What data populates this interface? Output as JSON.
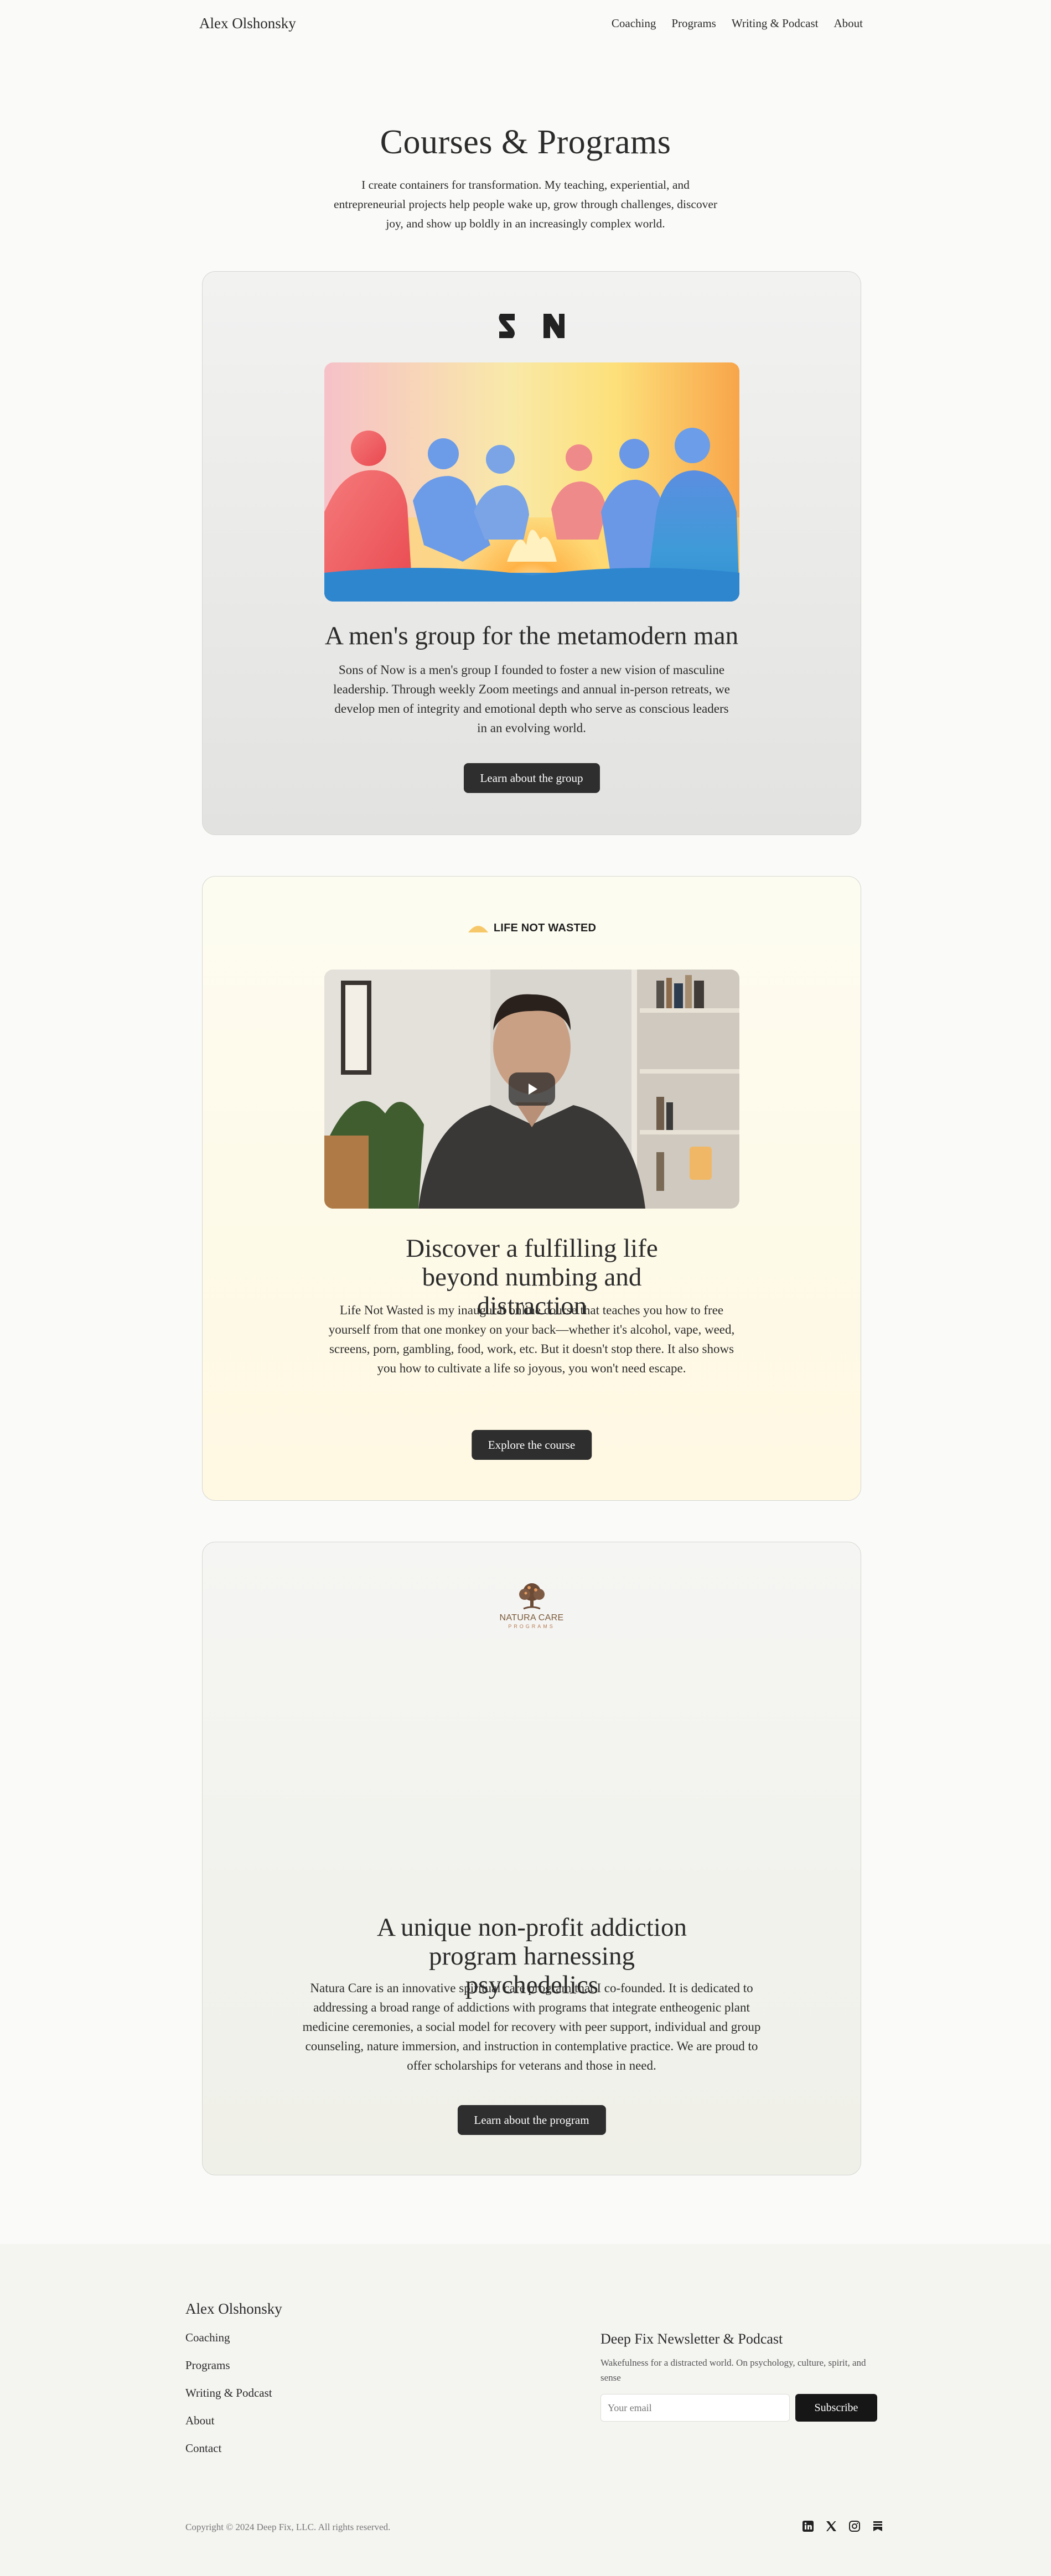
{
  "nav": {
    "brand": "Alex Olshonsky",
    "links": [
      "Coaching",
      "Programs",
      "Writing & Podcast",
      "About"
    ]
  },
  "hero": {
    "title": "Courses & Programs",
    "description": "I create containers for transformation. My teaching, experiential, and entrepreneurial projects help people wake up, grow through challenges, discover joy, and show up boldly in an increasingly complex world."
  },
  "cards": [
    {
      "logo": "SN",
      "title": "A men's group for the metamodern man",
      "description": "Sons of Now is a men's group I founded to foster a new vision of masculine leadership. Through weekly Zoom meetings and annual in-person retreats, we develop men of integrity and emotional depth who serve as conscious leaders in an evolving world.",
      "button": "Learn about the group"
    },
    {
      "logo": "LIFE NOT WASTED",
      "title": "Discover a fulfilling life beyond numbing and distraction",
      "description": "Life Not Wasted is my inaugural online course that teaches you how to free yourself from that one monkey on your back—whether it's alcohol, vape, weed, screens, porn, gambling, food, work, etc. But it doesn't stop there. It also shows you how to cultivate a life so joyous, you won't need escape.",
      "button": "Explore the course"
    },
    {
      "logo": "NATURA CARE",
      "logo_sub": "PROGRAMS",
      "title": "A unique non-profit addiction program harnessing psychedelics",
      "description": "Natura Care is an innovative spiritual care program that I co-founded. It is dedicated to addressing a broad range of addictions with programs that integrate entheogenic plant medicine ceremonies, a social model for recovery with peer support, individual and group counseling, nature immersion, and instruction in contemplative practice. We are proud to offer scholarships for veterans and those in need.",
      "button": "Learn about the program"
    }
  ],
  "footer": {
    "brand": "Alex Olshonsky",
    "links": [
      "Coaching",
      "Programs",
      "Writing & Podcast",
      "About",
      "Contact"
    ],
    "newsletter": {
      "title": "Deep Fix Newsletter & Podcast",
      "description": "Wakefulness for a distracted world. On psychology, culture, spirit, and sense",
      "placeholder": "Your email",
      "button": "Subscribe"
    },
    "copyright": "Copyright © 2024 Deep Fix, LLC. All rights reserved.",
    "social_icons": [
      "linkedin-icon",
      "x-icon",
      "instagram-icon",
      "substack-icon"
    ]
  },
  "colors": {
    "button": "#2e2e2e",
    "subscribe_button": "#161616",
    "background": "#fafaf8"
  }
}
